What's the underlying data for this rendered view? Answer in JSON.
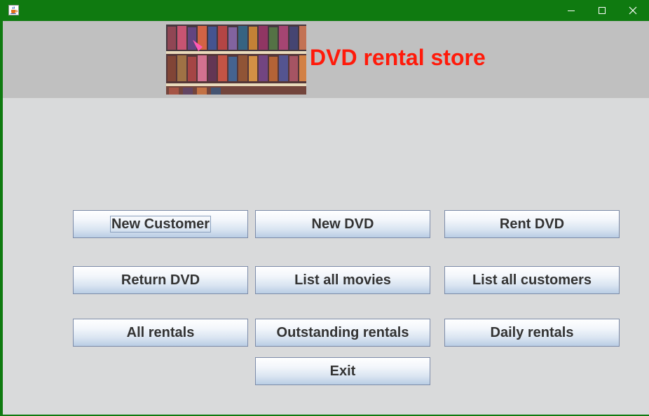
{
  "window": {
    "icon": "java-cup-icon",
    "controls": {
      "minimize": "minimize-icon",
      "maximize": "maximize-icon",
      "close": "close-icon"
    }
  },
  "header": {
    "title": "DVD rental store",
    "title_color": "#ff1a0a",
    "banner_image": "dvd-shelves-photo"
  },
  "buttons": {
    "new_customer": "New Customer",
    "new_dvd": "New DVD",
    "rent_dvd": "Rent DVD",
    "return_dvd": "Return DVD",
    "list_all_movies": "List all movies",
    "list_all_customers": "List all customers",
    "all_rentals": "All rentals",
    "outstanding_rentals": "Outstanding rentals",
    "daily_rentals": "Daily rentals",
    "exit": "Exit"
  },
  "colors": {
    "titlebar": "#0f7a10",
    "header_bg": "#c0c0c0",
    "panel_bg": "#d9dadb",
    "button_text": "#333333"
  }
}
